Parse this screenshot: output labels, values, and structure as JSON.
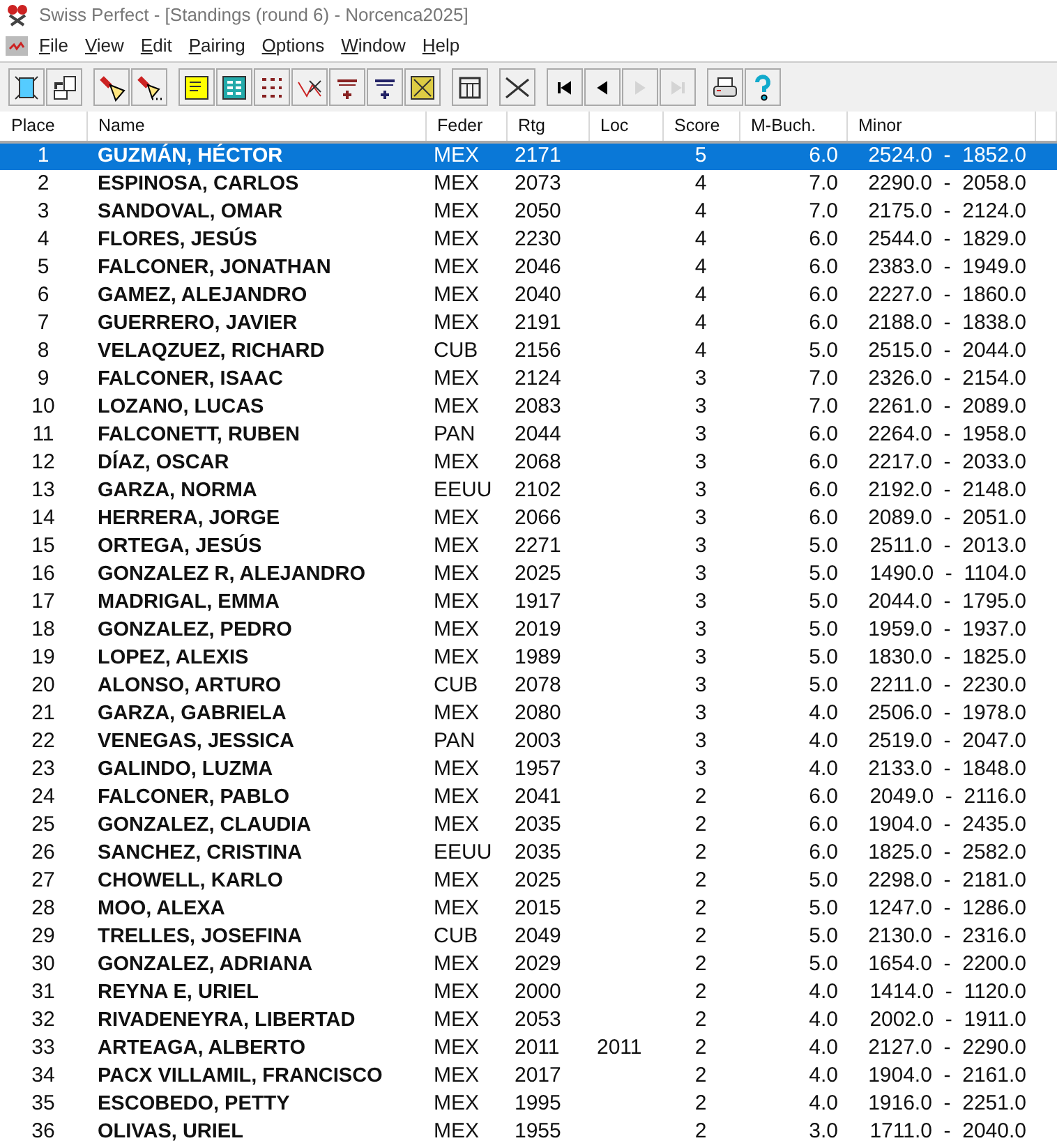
{
  "window": {
    "title": "Swiss Perfect - [Standings  (round 6) - Norcenca2025]"
  },
  "menu": [
    "File",
    "View",
    "Edit",
    "Pairing",
    "Options",
    "Window",
    "Help"
  ],
  "toolbar": [
    {
      "disabled": false
    },
    {
      "disabled": false
    },
    {
      "disabled": false
    },
    {
      "disabled": false
    },
    {
      "disabled": false
    },
    {
      "disabled": false
    },
    {
      "disabled": false
    },
    {
      "disabled": false
    },
    {
      "disabled": false
    },
    {
      "disabled": false
    },
    {
      "disabled": false
    },
    {
      "disabled": false
    },
    {
      "disabled": false
    },
    {
      "disabled": false
    },
    {
      "disabled": false
    },
    {
      "disabled": true
    },
    {
      "disabled": true
    },
    {
      "disabled": false
    },
    {
      "disabled": false
    }
  ],
  "table": {
    "columns": [
      "Place",
      "Name",
      "Feder",
      "Rtg",
      "Loc",
      "Score",
      "M-Buch.",
      "Minor"
    ],
    "rows": [
      {
        "place": "1",
        "name": "GUZMÁN, HÉCTOR",
        "feder": "MEX",
        "rtg": "2171",
        "score": "5",
        "mbuch": "6.0",
        "minor": "2524.0  -  1852.0",
        "selected": true
      },
      {
        "place": "2",
        "name": "ESPINOSA, CARLOS",
        "feder": "MEX",
        "rtg": "2073",
        "score": "4",
        "mbuch": "7.0",
        "minor": "2290.0  -  2058.0",
        "selected": false
      },
      {
        "place": "3",
        "name": "SANDOVAL, OMAR",
        "feder": "MEX",
        "rtg": "2050",
        "score": "4",
        "mbuch": "7.0",
        "minor": "2175.0  -  2124.0",
        "selected": false
      },
      {
        "place": "4",
        "name": "FLORES, JESÚS",
        "feder": "MEX",
        "rtg": "2230",
        "score": "4",
        "mbuch": "6.0",
        "minor": "2544.0  -  1829.0",
        "selected": false
      },
      {
        "place": "5",
        "name": "FALCONER, JONATHAN",
        "feder": "MEX",
        "rtg": "2046",
        "score": "4",
        "mbuch": "6.0",
        "minor": "2383.0  -  1949.0",
        "selected": false
      },
      {
        "place": "6",
        "name": "GAMEZ, ALEJANDRO",
        "feder": "MEX",
        "rtg": "2040",
        "score": "4",
        "mbuch": "6.0",
        "minor": "2227.0  -  1860.0",
        "selected": false
      },
      {
        "place": "7",
        "name": "GUERRERO, JAVIER",
        "feder": "MEX",
        "rtg": "2191",
        "score": "4",
        "mbuch": "6.0",
        "minor": "2188.0  -  1838.0",
        "selected": false
      },
      {
        "place": "8",
        "name": "VELAQZUEZ, RICHARD",
        "feder": "CUB",
        "rtg": "2156",
        "score": "4",
        "mbuch": "5.0",
        "minor": "2515.0  -  2044.0",
        "selected": false
      },
      {
        "place": "9",
        "name": "FALCONER, ISAAC",
        "feder": "MEX",
        "rtg": "2124",
        "score": "3",
        "mbuch": "7.0",
        "minor": "2326.0  -  2154.0",
        "selected": false
      },
      {
        "place": "10",
        "name": "LOZANO, LUCAS",
        "feder": "MEX",
        "rtg": "2083",
        "score": "3",
        "mbuch": "7.0",
        "minor": "2261.0  -  2089.0",
        "selected": false
      },
      {
        "place": "11",
        "name": "FALCONETT, RUBEN",
        "feder": "PAN",
        "rtg": "2044",
        "score": "3",
        "mbuch": "6.0",
        "minor": "2264.0  -  1958.0",
        "selected": false
      },
      {
        "place": "12",
        "name": "DÍAZ, OSCAR",
        "feder": "MEX",
        "rtg": "2068",
        "score": "3",
        "mbuch": "6.0",
        "minor": "2217.0  -  2033.0",
        "selected": false
      },
      {
        "place": "13",
        "name": "GARZA, NORMA",
        "feder": "EEUU",
        "rtg": "2102",
        "score": "3",
        "mbuch": "6.0",
        "minor": "2192.0  -  2148.0",
        "selected": false
      },
      {
        "place": "14",
        "name": "HERRERA, JORGE",
        "feder": "MEX",
        "rtg": "2066",
        "score": "3",
        "mbuch": "6.0",
        "minor": "2089.0  -  2051.0",
        "selected": false
      },
      {
        "place": "15",
        "name": "ORTEGA, JESÚS",
        "feder": "MEX",
        "rtg": "2271",
        "score": "3",
        "mbuch": "5.0",
        "minor": "2511.0  -  2013.0",
        "selected": false
      },
      {
        "place": "16",
        "name": "GONZALEZ R, ALEJANDRO",
        "feder": "MEX",
        "rtg": "2025",
        "score": "3",
        "mbuch": "5.0",
        "minor": "1490.0  -  1104.0",
        "selected": false
      },
      {
        "place": "17",
        "name": "MADRIGAL, EMMA",
        "feder": "MEX",
        "rtg": "1917",
        "score": "3",
        "mbuch": "5.0",
        "minor": "2044.0  -  1795.0",
        "selected": false
      },
      {
        "place": "18",
        "name": "GONZALEZ, PEDRO",
        "feder": "MEX",
        "rtg": "2019",
        "score": "3",
        "mbuch": "5.0",
        "minor": "1959.0  -  1937.0",
        "selected": false
      },
      {
        "place": "19",
        "name": "LOPEZ, ALEXIS",
        "feder": "MEX",
        "rtg": "1989",
        "score": "3",
        "mbuch": "5.0",
        "minor": "1830.0  -  1825.0",
        "selected": false
      },
      {
        "place": "20",
        "name": "ALONSO, ARTURO",
        "feder": "CUB",
        "rtg": "2078",
        "score": "3",
        "mbuch": "5.0",
        "minor": "2211.0  -  2230.0",
        "selected": false
      },
      {
        "place": "21",
        "name": "GARZA, GABRIELA",
        "feder": "MEX",
        "rtg": "2080",
        "score": "3",
        "mbuch": "4.0",
        "minor": "2506.0  -  1978.0",
        "selected": false
      },
      {
        "place": "22",
        "name": "VENEGAS, JESSICA",
        "feder": "PAN",
        "rtg": "2003",
        "score": "3",
        "mbuch": "4.0",
        "minor": "2519.0  -  2047.0",
        "selected": false
      },
      {
        "place": "23",
        "name": "GALINDO, LUZMA",
        "feder": "MEX",
        "rtg": "1957",
        "score": "3",
        "mbuch": "4.0",
        "minor": "2133.0  -  1848.0",
        "selected": false
      },
      {
        "place": "24",
        "name": "FALCONER, PABLO",
        "feder": "MEX",
        "rtg": "2041",
        "score": "2",
        "mbuch": "6.0",
        "minor": "2049.0  -  2116.0",
        "selected": false
      },
      {
        "place": "25",
        "name": "GONZALEZ, CLAUDIA",
        "feder": "MEX",
        "rtg": "2035",
        "score": "2",
        "mbuch": "6.0",
        "minor": "1904.0  -  2435.0",
        "selected": false
      },
      {
        "place": "26",
        "name": "SANCHEZ, CRISTINA",
        "feder": "EEUU",
        "rtg": "2035",
        "score": "2",
        "mbuch": "6.0",
        "minor": "1825.0  -  2582.0",
        "selected": false
      },
      {
        "place": "27",
        "name": "CHOWELL, KARLO",
        "feder": "MEX",
        "rtg": "2025",
        "score": "2",
        "mbuch": "5.0",
        "minor": "2298.0  -  2181.0",
        "selected": false
      },
      {
        "place": "28",
        "name": "MOO, ALEXA",
        "feder": "MEX",
        "rtg": "2015",
        "score": "2",
        "mbuch": "5.0",
        "minor": "1247.0  -  1286.0",
        "selected": false
      },
      {
        "place": "29",
        "name": "TRELLES, JOSEFINA",
        "feder": "CUB",
        "rtg": "2049",
        "score": "2",
        "mbuch": "5.0",
        "minor": "2130.0  -  2316.0",
        "selected": false
      },
      {
        "place": "30",
        "name": "GONZALEZ, ADRIANA",
        "feder": "MEX",
        "rtg": "2029",
        "score": "2",
        "mbuch": "5.0",
        "minor": "1654.0  -  2200.0",
        "selected": false
      },
      {
        "place": "31",
        "name": "REYNA E, URIEL",
        "feder": "MEX",
        "rtg": "2000",
        "score": "2",
        "mbuch": "4.0",
        "minor": "1414.0  -  1120.0",
        "selected": false
      },
      {
        "place": "32",
        "name": "RIVADENEYRA, LIBERTAD",
        "feder": "MEX",
        "rtg": "2053",
        "score": "2",
        "mbuch": "4.0",
        "minor": "2002.0  -  1911.0",
        "selected": false
      },
      {
        "place": "33",
        "name": "ARTEAGA, ALBERTO",
        "feder": "MEX",
        "rtg": "2011",
        "loc": "2011",
        "score": "2",
        "mbuch": "4.0",
        "minor": "2127.0  -  2290.0",
        "selected": false
      },
      {
        "place": "34",
        "name": "PACX VILLAMIL, FRANCISCO",
        "feder": "MEX",
        "rtg": "2017",
        "score": "2",
        "mbuch": "4.0",
        "minor": "1904.0  -  2161.0",
        "selected": false
      },
      {
        "place": "35",
        "name": "ESCOBEDO, PETTY",
        "feder": "MEX",
        "rtg": "1995",
        "score": "2",
        "mbuch": "4.0",
        "minor": "1916.0  -  2251.0",
        "selected": false
      },
      {
        "place": "36",
        "name": "OLIVAS, URIEL",
        "feder": "MEX",
        "rtg": "1955",
        "score": "2",
        "mbuch": "3.0",
        "minor": "1711.0  -  2040.0",
        "selected": false
      }
    ]
  }
}
